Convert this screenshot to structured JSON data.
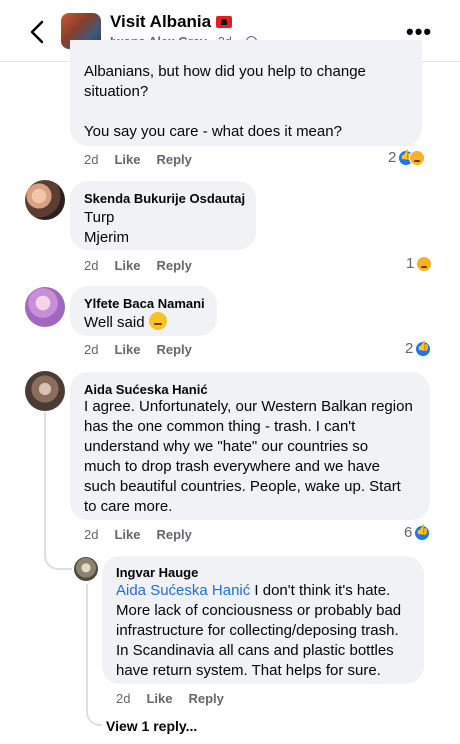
{
  "header": {
    "page_name": "Visit Albania",
    "author": "Iwona Alex Grey",
    "meta": " · 2d · "
  },
  "comments": [
    {
      "text_lines": [
        "Albanians, but how did you help to change",
        "situation?",
        "",
        "You say you care - what does it mean?"
      ],
      "time": "2d",
      "like": "Like",
      "reply": "Reply",
      "reaction_count": "2"
    },
    {
      "name": "Skenda Bukurije Osdautaj",
      "text_lines": [
        "Turp",
        "Mjerim"
      ],
      "time": "2d",
      "like": "Like",
      "reply": "Reply",
      "reaction_count": "1"
    },
    {
      "name": "Ylfete Baca Namani",
      "text": "Well said",
      "time": "2d",
      "like": "Like",
      "reply": "Reply",
      "reaction_count": "2"
    },
    {
      "name": "Aida Sućeska Hanić",
      "text_lines": [
        "I agree. Unfortunately, our Western Balkan region",
        "has the one common thing - trash. I can't",
        "understand why we \"hate\" our countries so",
        "much to drop trash everywhere and we have",
        "such beautiful countries. People, wake up. Start",
        "to care more."
      ],
      "time": "2d",
      "like": "Like",
      "reply": "Reply",
      "reaction_count": "6"
    }
  ],
  "reply": {
    "name": "Ingvar Hauge",
    "mention": "Aida Sućeska Hanić",
    "text_first": " I don't think it's hate.",
    "text_lines": [
      "More lack of conciousness or probably bad",
      "infrastructure for collecting/deposing trash.",
      "In Scandinavia all cans and plastic bottles",
      "have return system. That helps for sure."
    ],
    "time": "2d",
    "like": "Like",
    "reply": "Reply"
  },
  "view_replies": "View 1 reply...",
  "icons": {
    "back": "chevron-left-icon",
    "more": "more-horizontal-icon",
    "globe": "globe-icon",
    "like_reaction": "like-reaction-icon",
    "sad_reaction": "sad-reaction-icon"
  },
  "colors": {
    "accent": "#1877f2",
    "bubble": "#f0f2f5",
    "secondary_text": "#65676b",
    "mention": "#216fdb"
  }
}
